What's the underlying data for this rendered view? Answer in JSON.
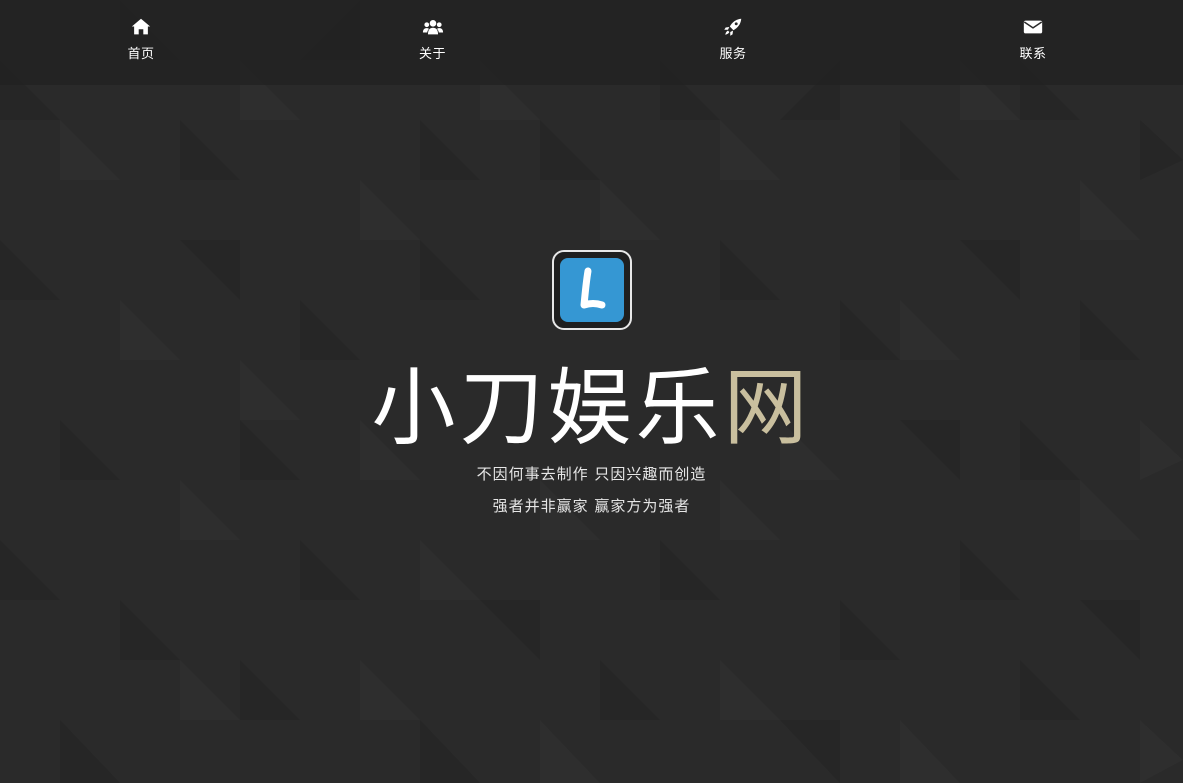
{
  "nav": {
    "items": [
      {
        "label": "首页",
        "icon": "home-icon"
      },
      {
        "label": "关于",
        "icon": "users-icon"
      },
      {
        "label": "服务",
        "icon": "rocket-icon"
      },
      {
        "label": "联系",
        "icon": "envelope-icon"
      }
    ]
  },
  "hero": {
    "logo_letter": "L",
    "title_main": "小刀娱乐",
    "title_accent": "网",
    "slogan_line1": "不因何事去制作 只因兴趣而创造",
    "slogan_line2": "强者并非赢家 赢家方为强者"
  },
  "colors": {
    "background": "#2a2a2a",
    "accent": "#c9bf9e",
    "logo_blue": "#3597d3"
  }
}
